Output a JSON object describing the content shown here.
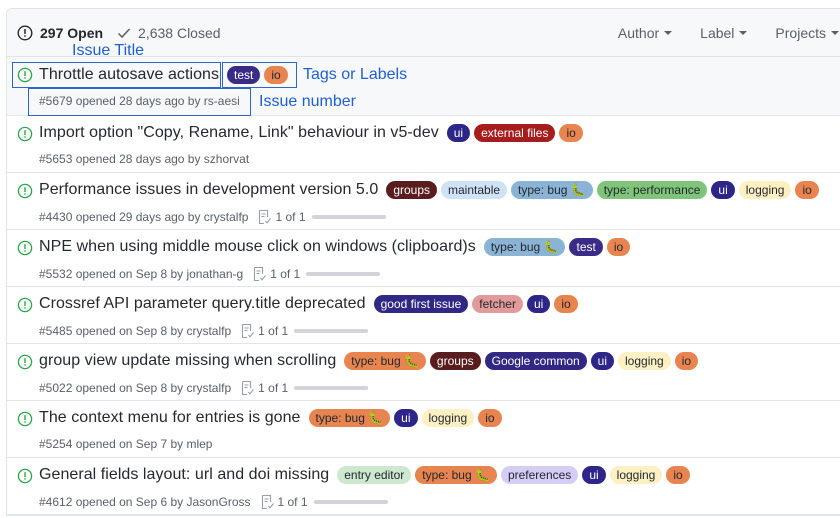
{
  "header": {
    "open_count_label": "297 Open",
    "closed_count_label": "2,638 Closed",
    "filters": [
      {
        "label": "Author"
      },
      {
        "label": "Label"
      },
      {
        "label": "Projects"
      }
    ]
  },
  "label_colors": {
    "test": {
      "bg": "#3a2b86",
      "fg": "#ffffff"
    },
    "io": {
      "bg": "#e7844f",
      "fg": "#24292e"
    },
    "ui": {
      "bg": "#2d2588",
      "fg": "#ffffff"
    },
    "external files": {
      "bg": "#a51d1d",
      "fg": "#ffffff"
    },
    "groups": {
      "bg": "#5a1d1d",
      "fg": "#ffffff"
    },
    "maintable": {
      "bg": "#cfe2f6",
      "fg": "#24292e"
    },
    "type: bug": {
      "bg": "#8ab3d6",
      "fg": "#24292e"
    },
    "type: bug orange": {
      "bg": "#e7844f",
      "fg": "#24292e"
    },
    "type: performance": {
      "bg": "#7fc47a",
      "fg": "#24292e"
    },
    "logging": {
      "bg": "#fdf0c2",
      "fg": "#24292e"
    },
    "good first issue": {
      "bg": "#302883",
      "fg": "#ffffff"
    },
    "fetcher": {
      "bg": "#e39a9a",
      "fg": "#24292e"
    },
    "Google common": {
      "bg": "#302883",
      "fg": "#ffffff"
    },
    "entry editor": {
      "bg": "#cde8cf",
      "fg": "#24292e"
    },
    "preferences": {
      "bg": "#d5cdf5",
      "fg": "#24292e"
    }
  },
  "issues": [
    {
      "title": "Throttle autosave actions",
      "labels": [
        {
          "name": "test",
          "key": "test"
        },
        {
          "name": "io",
          "key": "io"
        }
      ],
      "meta": "#5679 opened 28 days ago by rs-aesi",
      "tasks": null,
      "selected": true
    },
    {
      "title": "Import option \"Copy, Rename, Link\" behaviour in v5-dev",
      "labels": [
        {
          "name": "ui",
          "key": "ui"
        },
        {
          "name": "external files",
          "key": "external files"
        },
        {
          "name": "io",
          "key": "io"
        }
      ],
      "meta": "#5653 opened 28 days ago by szhorvat",
      "tasks": null
    },
    {
      "title": "Performance issues in development version 5.0",
      "labels": [
        {
          "name": "groups",
          "key": "groups"
        },
        {
          "name": "maintable",
          "key": "maintable"
        },
        {
          "name": "type: bug 🐛",
          "key": "type: bug"
        },
        {
          "name": "type: performance",
          "key": "type: performance"
        },
        {
          "name": "ui",
          "key": "ui"
        },
        {
          "name": "logging",
          "key": "logging"
        },
        {
          "name": "io",
          "key": "io"
        }
      ],
      "meta": "#4430 opened 29 days ago by crystalfp",
      "tasks": {
        "label": "1 of 1",
        "progress": 1.0
      }
    },
    {
      "title": "NPE when using middle mouse click on windows (clipboard)s",
      "labels": [
        {
          "name": "type: bug 🐛",
          "key": "type: bug"
        },
        {
          "name": "test",
          "key": "test"
        },
        {
          "name": "io",
          "key": "io"
        }
      ],
      "meta": "#5532 opened on Sep 8 by jonathan-g",
      "tasks": {
        "label": "1 of 1",
        "progress": 1.0
      }
    },
    {
      "title": "Crossref API parameter query.title deprecated",
      "labels": [
        {
          "name": "good first issue",
          "key": "good first issue"
        },
        {
          "name": "fetcher",
          "key": "fetcher"
        },
        {
          "name": "ui",
          "key": "ui"
        },
        {
          "name": "io",
          "key": "io"
        }
      ],
      "meta": "#5485 opened on Sep 8 by crystalfp",
      "tasks": {
        "label": "1 of 1",
        "progress": 1.0
      }
    },
    {
      "title": "group view update missing when scrolling",
      "labels": [
        {
          "name": "type: bug 🐛",
          "key": "type: bug orange"
        },
        {
          "name": "groups",
          "key": "groups"
        },
        {
          "name": "Google common",
          "key": "Google common"
        },
        {
          "name": "ui",
          "key": "ui"
        },
        {
          "name": "logging",
          "key": "logging"
        },
        {
          "name": "io",
          "key": "io"
        }
      ],
      "meta": "#5022 opened on Sep 8 by crystalfp",
      "tasks": {
        "label": "1 of 1",
        "progress": 1.0
      }
    },
    {
      "title": "The context menu for entries is gone",
      "labels": [
        {
          "name": "type: bug 🐛",
          "key": "type: bug orange"
        },
        {
          "name": "ui",
          "key": "ui"
        },
        {
          "name": "logging",
          "key": "logging"
        },
        {
          "name": "io",
          "key": "io"
        }
      ],
      "meta": "#5254 opened on Sep 7 by mlep",
      "tasks": null
    },
    {
      "title": "General fields layout: url and doi missing",
      "labels": [
        {
          "name": "entry editor",
          "key": "entry editor"
        },
        {
          "name": "type: bug 🐛",
          "key": "type: bug orange"
        },
        {
          "name": "preferences",
          "key": "preferences"
        },
        {
          "name": "ui",
          "key": "ui"
        },
        {
          "name": "logging",
          "key": "logging"
        },
        {
          "name": "io",
          "key": "io"
        }
      ],
      "meta": "#4612 opened on Sep 6 by JasonGross",
      "tasks": {
        "label": "1 of 1",
        "progress": 1.0
      }
    }
  ],
  "annotations": {
    "issue_title": "Issue Title",
    "tags_or_labels": "Tags or Labels",
    "issue_number": "Issue number"
  }
}
